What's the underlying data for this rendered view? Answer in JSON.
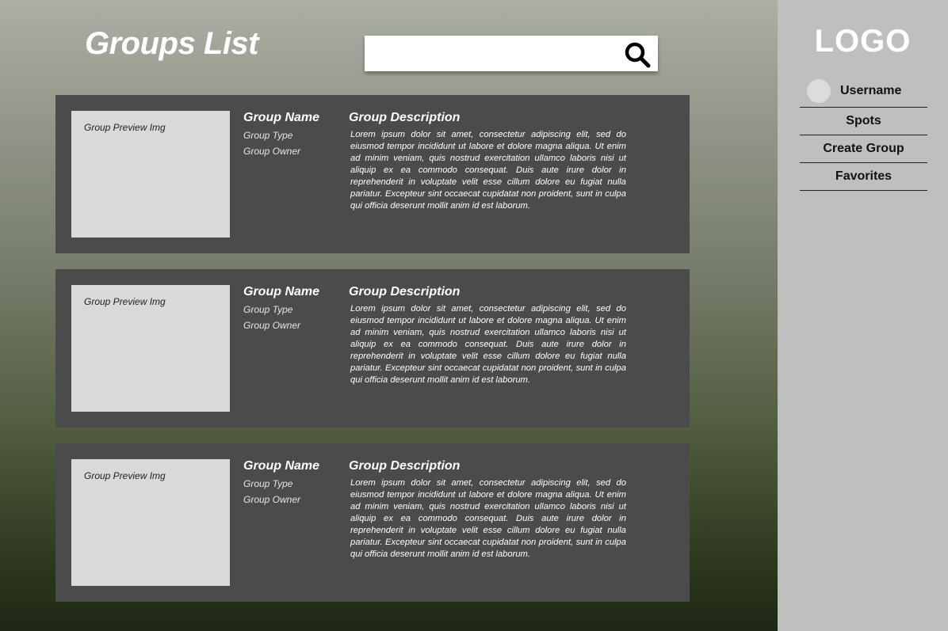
{
  "header": {
    "title": "Groups List",
    "search": {
      "value": "",
      "placeholder": "",
      "icon": "search-icon"
    }
  },
  "groups": [
    {
      "image_label": "Group Preview Img",
      "name": "Group Name",
      "type": "Group Type",
      "owner": "Group Owner",
      "description_title": "Group Description",
      "description": "Lorem ipsum dolor sit amet, consectetur adipiscing elit, sed do eiusmod tempor incididunt ut labore et dolore magna aliqua. Ut enim ad minim veniam, quis nostrud exercitation ullamco laboris nisi ut aliquip ex ea commodo consequat. Duis aute irure dolor in reprehenderit in voluptate velit esse cillum dolore eu fugiat nulla pariatur. Excepteur sint occaecat cupidatat non proident, sunt in culpa qui officia deserunt mollit anim id est laborum."
    },
    {
      "image_label": "Group Preview Img",
      "name": "Group Name",
      "type": "Group Type",
      "owner": "Group Owner",
      "description_title": "Group Description",
      "description": "Lorem ipsum dolor sit amet, consectetur adipiscing elit, sed do eiusmod tempor incididunt ut labore et dolore magna aliqua. Ut enim ad minim veniam, quis nostrud exercitation ullamco laboris nisi ut aliquip ex ea commodo consequat. Duis aute irure dolor in reprehenderit in voluptate velit esse cillum dolore eu fugiat nulla pariatur. Excepteur sint occaecat cupidatat non proident, sunt in culpa qui officia deserunt mollit anim id est laborum."
    },
    {
      "image_label": "Group Preview Img",
      "name": "Group Name",
      "type": "Group Type",
      "owner": "Group Owner",
      "description_title": "Group Description",
      "description": "Lorem ipsum dolor sit amet, consectetur adipiscing elit, sed do eiusmod tempor incididunt ut labore et dolore magna aliqua. Ut enim ad minim veniam, quis nostrud exercitation ullamco laboris nisi ut aliquip ex ea commodo consequat. Duis aute irure dolor in reprehenderit in voluptate velit esse cillum dolore eu fugiat nulla pariatur. Excepteur sint occaecat cupidatat non proident, sunt in culpa qui officia deserunt mollit anim id est laborum."
    }
  ],
  "sidebar": {
    "logo": "LOGO",
    "username": "Username",
    "nav": [
      {
        "label": "Spots"
      },
      {
        "label": "Create Group"
      },
      {
        "label": "Favorites"
      }
    ]
  },
  "colors": {
    "card_background": "#4b4b4b",
    "image_placeholder": "#d9d9d9",
    "sidebar_background": "#bfbfbf",
    "text_light": "#ffffff"
  }
}
